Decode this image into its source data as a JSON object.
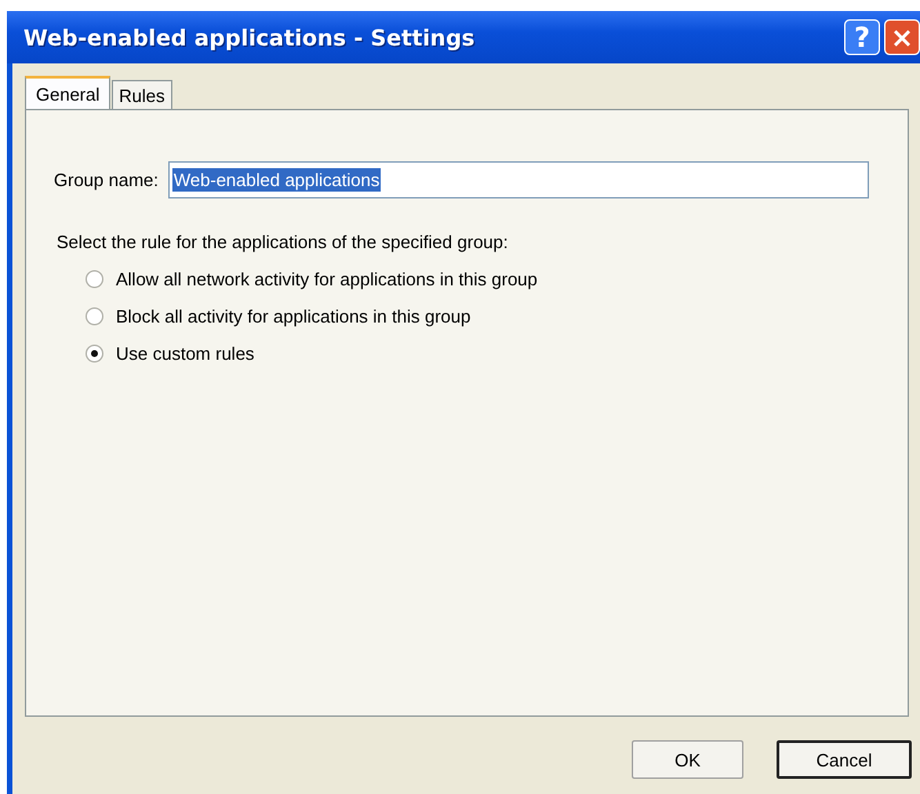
{
  "window": {
    "title": "Web-enabled applications - Settings"
  },
  "title_buttons": [
    {
      "kind": "help",
      "label": "?"
    },
    {
      "kind": "close",
      "label": "×"
    }
  ],
  "tabs": [
    {
      "label": "General",
      "selected": true
    },
    {
      "label": "Rules",
      "selected": false
    }
  ],
  "group_name": {
    "label": "Group name:",
    "value": "Web-enabled applications",
    "text_selected": true
  },
  "rule_prompt": "Select the rule for the applications of the specified group:",
  "rules": [
    {
      "label": "Allow all network activity for applications in this group",
      "selected": false
    },
    {
      "label": "Block all activity for applications in this group",
      "selected": false
    },
    {
      "label": "Use custom rules",
      "selected": true
    }
  ],
  "buttons": [
    {
      "label": "OK",
      "default": false
    },
    {
      "label": "Cancel",
      "default": true
    }
  ]
}
